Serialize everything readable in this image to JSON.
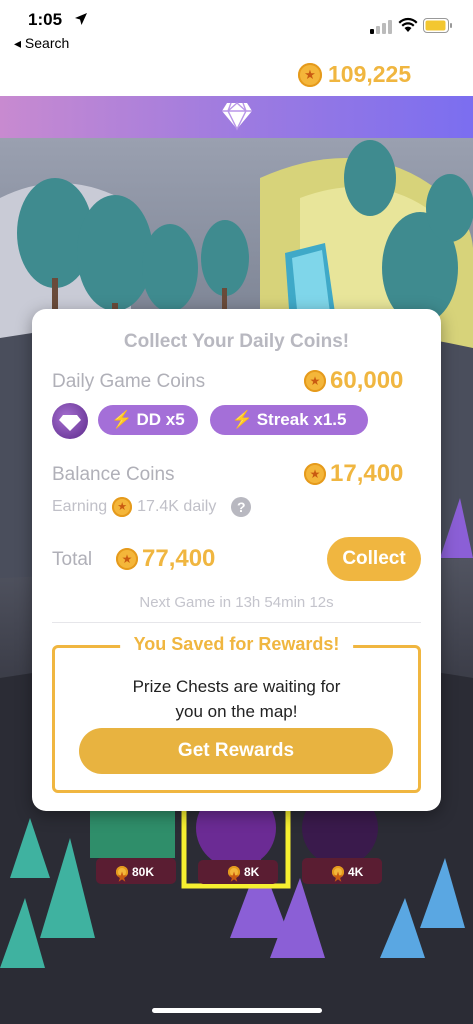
{
  "status_bar": {
    "time": "1:05",
    "back_label": "◂ Search"
  },
  "header": {
    "coin_balance": "109,225"
  },
  "scene": {
    "chests": [
      {
        "value": "80K"
      },
      {
        "value": "8K"
      },
      {
        "value": "4K"
      }
    ]
  },
  "modal": {
    "title": "Collect Your Daily Coins!",
    "daily_label": "Daily Game Coins",
    "daily_value": "60,000",
    "boost_dd": "DD x5",
    "boost_streak": "Streak x1.5",
    "balance_label": "Balance Coins",
    "balance_value": "17,400",
    "earning_label": "Earning",
    "earning_value": "17.4K daily",
    "help_icon": "?",
    "total_label": "Total",
    "total_value": "77,400",
    "collect_label": "Collect",
    "next_game": "Next Game in 13h 54min 12s",
    "rewards_title": "You Saved for Rewards!",
    "rewards_line1": "Prize Chests are waiting for",
    "rewards_line2": "you on the map!",
    "get_rewards_label": "Get Rewards"
  },
  "colors": {
    "accent": "#f0b640",
    "gem_purple": "#a46fd8",
    "gem_bar_start": "#c88ad0",
    "gem_bar_end": "#7b6ef0"
  }
}
